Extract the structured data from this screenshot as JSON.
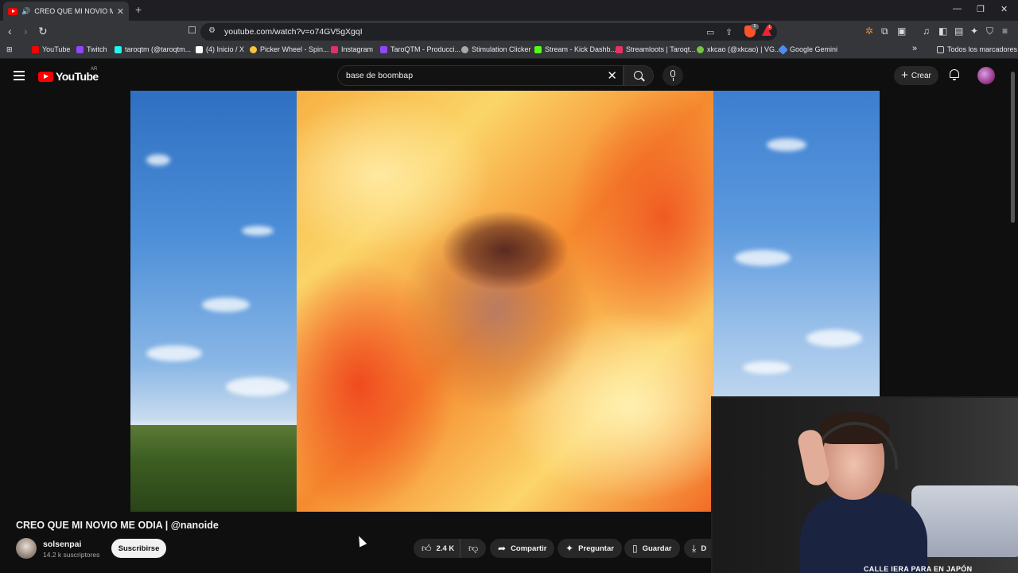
{
  "browser": {
    "tab": {
      "title": "CREO QUE MI NOVIO ME OD",
      "audio_icon": "speaker-icon",
      "close": "✕"
    },
    "new_tab": "+",
    "window_controls": [
      "—",
      "❐",
      "✕"
    ],
    "url": "youtube.com/watch?v=o74GV5gXgqI",
    "bookmarks": [
      {
        "label": "YouTube",
        "color": "#ff0000"
      },
      {
        "label": "Twitch",
        "color": "#9146ff"
      },
      {
        "label": "taroqtm (@taroqtm...",
        "color": "#25f4ee"
      },
      {
        "label": "(4) Inicio / X",
        "color": "#ffffff"
      },
      {
        "label": "Picker Wheel - Spin...",
        "color": "#f5c542"
      },
      {
        "label": "Instagram",
        "color": "#e1306c"
      },
      {
        "label": "TaroQTM - Producci...",
        "color": "#9146ff"
      },
      {
        "label": "Stimulation Clicker",
        "color": "#aaaaaa"
      },
      {
        "label": "Stream - Kick Dashb...",
        "color": "#53fc18"
      },
      {
        "label": "Streamloots | Taroqt...",
        "color": "#e6335f"
      },
      {
        "label": "xkcao (@xkcao) | VG...",
        "color": "#76c442"
      },
      {
        "label": "Google Gemini",
        "color": "#4e8cf5"
      }
    ],
    "bookmarks_overflow": "»",
    "all_bookmarks": "Todos los marcadores",
    "brave_badge": "5",
    "reward_badge": "1"
  },
  "youtube": {
    "logo_text": "YouTube",
    "country_code": "AR",
    "search_query": "base de boombap",
    "create_label": "Crear",
    "video": {
      "title": "CREO QUE MI NOVIO ME ODIA | @nanoide",
      "channel": "solsenpai",
      "subscribers": "14.2 k suscriptores",
      "subscribe_label": "Suscribirse",
      "likes": "2.4 K",
      "share_label": "Compartir",
      "ask_label": "Preguntar",
      "save_label": "Guardar",
      "download_label": "D"
    },
    "webcam_caption": "CALLE IERA PARA EN JAPÓN"
  }
}
